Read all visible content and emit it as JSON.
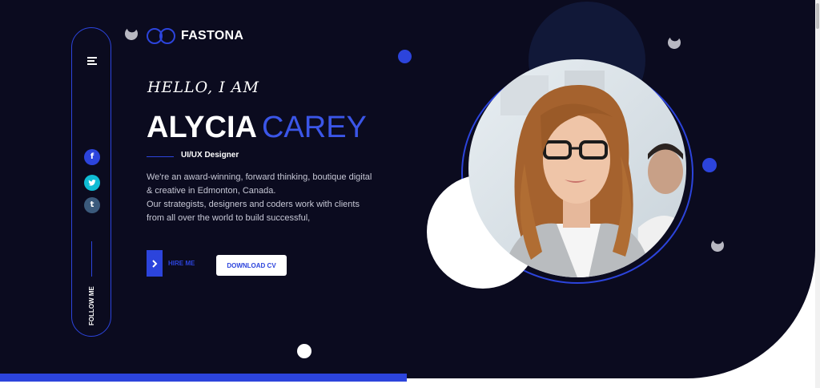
{
  "brand": {
    "name": "FASTONA",
    "logo_icon": "infinity-icon"
  },
  "sidebar": {
    "social": [
      {
        "name": "facebook",
        "glyph": "f"
      },
      {
        "name": "twitter",
        "glyph": "t"
      },
      {
        "name": "tumblr",
        "glyph": "t"
      }
    ],
    "follow_label": "FOLLOW ME"
  },
  "hero": {
    "greeting": "HELLO, I AM",
    "first_name": "ALYCIA",
    "last_name": "CAREY",
    "role": "UI/UX Designer",
    "description_1": "We're an award-winning, forward thinking, boutique digital & creative in Edmonton, Canada.",
    "description_2": "Our strategists, designers and coders work with clients from all over the world to build successful,"
  },
  "actions": {
    "hire_label": "HIRE ME",
    "hire_icon": "chevron-right-icon",
    "download_label": "DOWNLOAD CV"
  },
  "colors": {
    "background": "#0b0b1f",
    "accent": "#2c44dc",
    "text_light": "#c7c8d6"
  }
}
